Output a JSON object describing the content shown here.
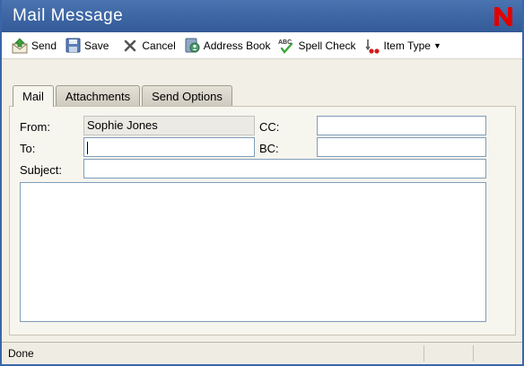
{
  "window": {
    "title": "Mail Message"
  },
  "toolbar": {
    "send": "Send",
    "save": "Save",
    "cancel": "Cancel",
    "address_book": "Address Book",
    "spell_check": "Spell Check",
    "item_type": "Item Type"
  },
  "tabs": [
    "Mail",
    "Attachments",
    "Send Options"
  ],
  "form": {
    "from_label": "From:",
    "from_value": "Sophie Jones",
    "cc_label": "CC:",
    "cc_value": "",
    "to_label": "To:",
    "to_value": "",
    "bc_label": "BC:",
    "bc_value": "",
    "subject_label": "Subject:",
    "subject_value": "",
    "body_value": ""
  },
  "status": {
    "text": "Done"
  },
  "icons": {
    "logo": "novell-n-logo",
    "send": "send-envelope-icon",
    "save": "floppy-disk-icon",
    "cancel": "x-cancel-icon",
    "address_book": "address-book-icon",
    "spell_check": "spell-check-icon",
    "item_type": "item-type-icon"
  },
  "colors": {
    "titlebar": "#3b64a2",
    "logo": "#e00000",
    "field_border": "#7f9db9"
  }
}
